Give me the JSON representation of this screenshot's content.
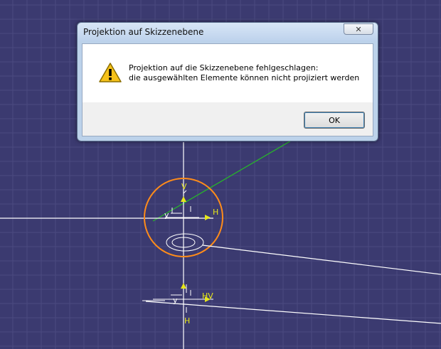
{
  "dialog": {
    "title": "Projektion auf Skizzenebene",
    "close_label": "✕",
    "message_line1": "Projektion auf die Skizzenebene fehlgeschlagen:",
    "message_line2": "die ausgewählten Elemente können nicht projiziert werden",
    "ok_label": "OK",
    "warning_icon": "warning-icon"
  },
  "sketch": {
    "labels": {
      "v1": "V",
      "h1": "H",
      "hv": "HV",
      "v2": "V",
      "h2": "H",
      "y": "y"
    },
    "colors": {
      "background": "#3b3a70",
      "grid": "#4b4a80",
      "axis": "#ffffff",
      "circle": "#ff8c1a",
      "line": "#27b52a",
      "label": "#e6e61a"
    }
  }
}
